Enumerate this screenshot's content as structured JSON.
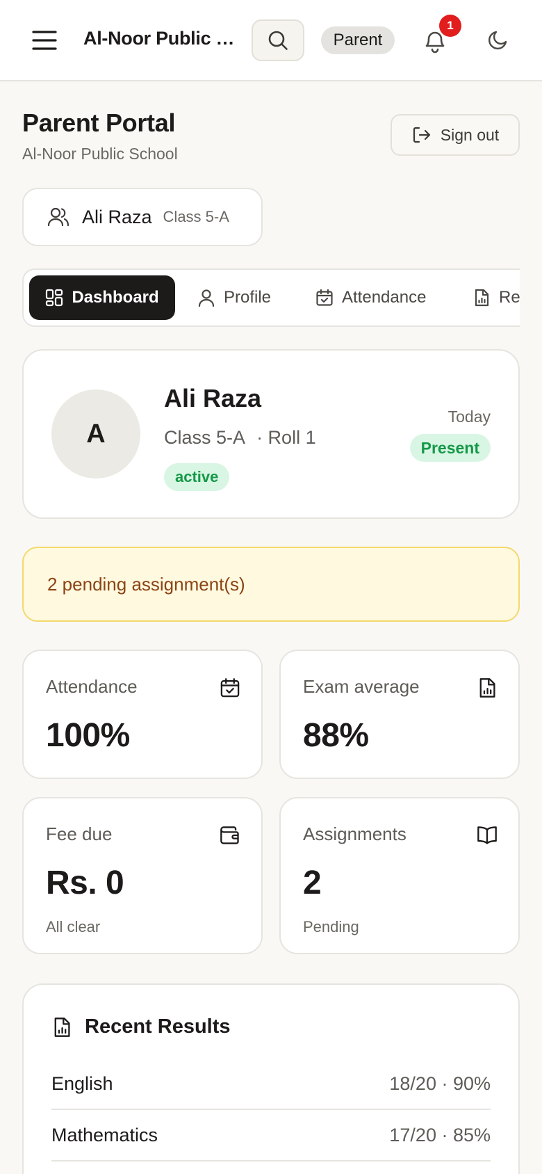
{
  "header": {
    "school_name": "Al-Noor Public School",
    "role": "Parent",
    "notification_count": "1"
  },
  "page": {
    "title": "Parent Portal",
    "subtitle": "Al-Noor Public School",
    "sign_out_label": "Sign out"
  },
  "child_selector": {
    "name": "Ali Raza",
    "class": "Class 5-A"
  },
  "tabs": [
    {
      "label": "Dashboard",
      "icon": "dashboard-icon",
      "active": true
    },
    {
      "label": "Profile",
      "icon": "user-icon"
    },
    {
      "label": "Attendance",
      "icon": "calendar-check-icon"
    },
    {
      "label": "Re",
      "icon": "file-chart-icon"
    }
  ],
  "student": {
    "initial": "A",
    "name": "Ali Raza",
    "class": "Class 5-A",
    "roll": "· Roll 1",
    "status": "active",
    "today_label": "Today",
    "today_status": "Present"
  },
  "alert": {
    "text": "2 pending assignment(s)"
  },
  "stats": {
    "attendance": {
      "label": "Attendance",
      "value": "100%",
      "icon": "calendar-check-icon"
    },
    "exam_average": {
      "label": "Exam average",
      "value": "88%",
      "icon": "file-chart-icon"
    },
    "fee_due": {
      "label": "Fee due",
      "value": "Rs. 0",
      "sub": "All clear",
      "icon": "wallet-icon"
    },
    "assignments": {
      "label": "Assignments",
      "value": "2",
      "sub": "Pending",
      "icon": "book-open-icon"
    }
  },
  "results": {
    "title": "Recent Results",
    "rows": [
      {
        "subject": "English",
        "score": "18/20 · 90%"
      },
      {
        "subject": "Mathematics",
        "score": "17/20 · 85%"
      }
    ]
  },
  "colors": {
    "background": "#f9f8f5",
    "dark": "#1c1b19",
    "success": "#159947",
    "success_bg": "#d9f6e5",
    "warning_bg": "#fff9e0",
    "warning_border": "#f3d96c",
    "warning_text": "#8b4413",
    "badge_red": "#e11d1d"
  }
}
